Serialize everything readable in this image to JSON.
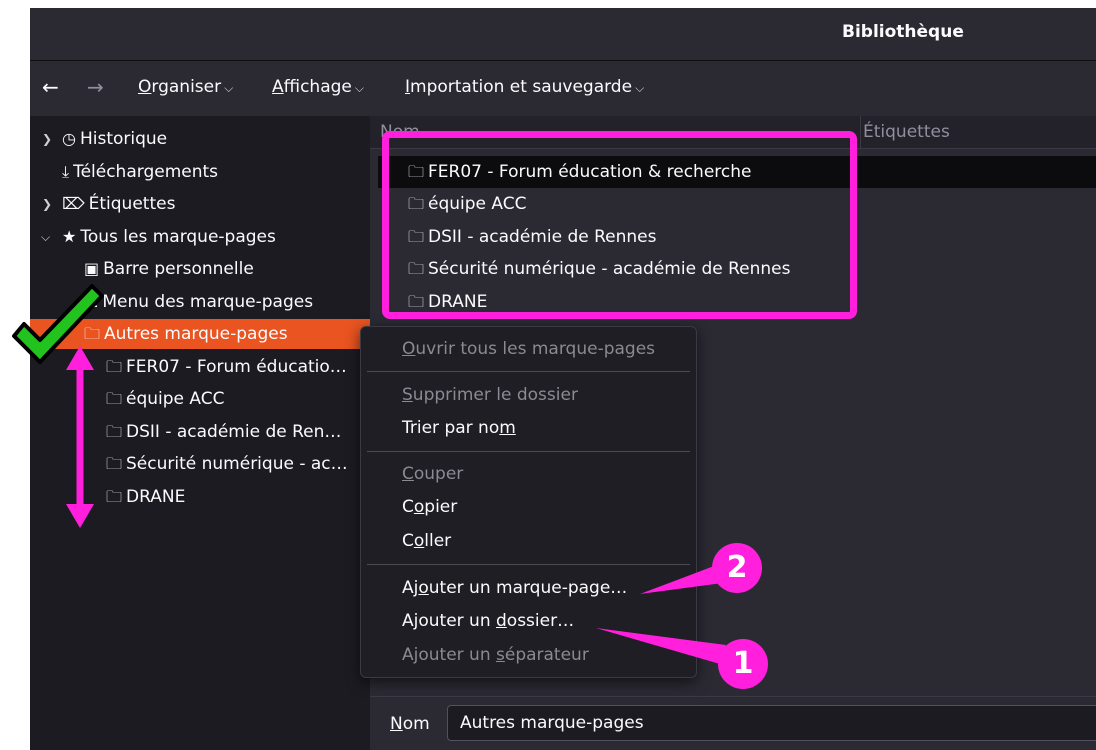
{
  "window": {
    "title": "Bibliothèque"
  },
  "toolbar": {
    "back_icon": "←",
    "forward_icon": "→",
    "organize_prefix": "O",
    "organize_rest": "rganiser",
    "view_prefix": "A",
    "view_rest": "ffichage",
    "import_prefix": "I",
    "import_rest": "mportation et sauvegarde"
  },
  "sidebar": {
    "items": [
      {
        "label": "Historique",
        "icon": "clock-icon"
      },
      {
        "label": "Téléchargements",
        "icon": "download-icon"
      },
      {
        "label": "Étiquettes",
        "icon": "tag-icon"
      },
      {
        "label": "Tous les marque-pages",
        "icon": "star-icon"
      },
      {
        "label": "Barre personnelle",
        "icon": "bookmarks-toolbar-icon"
      },
      {
        "label": "Menu des marque-pages",
        "icon": "bookmarks-menu-icon"
      },
      {
        "label": "Autres marque-pages",
        "icon": "folder-icon"
      },
      {
        "label": "FER07 - Forum éducatio…",
        "icon": "folder-icon"
      },
      {
        "label": "équipe ACC",
        "icon": "folder-icon"
      },
      {
        "label": "DSII - académie de Ren…",
        "icon": "folder-icon"
      },
      {
        "label": "Sécurité numérique - ac…",
        "icon": "folder-icon"
      },
      {
        "label": "DRANE",
        "icon": "folder-icon"
      }
    ]
  },
  "content": {
    "col_name": "Nom",
    "col_tags": "Étiquettes",
    "rows": [
      {
        "label": "FER07 - Forum éducation & recherche"
      },
      {
        "label": "équipe ACC"
      },
      {
        "label": "DSII - académie de Rennes"
      },
      {
        "label": "Sécurité numérique - académie de Rennes"
      },
      {
        "label": "DRANE"
      }
    ]
  },
  "context_menu": {
    "open_all": {
      "pre": "",
      "acc": "O",
      "post": "uvrir tous les marque-pages"
    },
    "delete_folder": {
      "pre": "",
      "acc": "S",
      "post": "upprimer le dossier"
    },
    "sort_by_name": {
      "pre": "Trier par no",
      "acc": "m",
      "post": ""
    },
    "cut": {
      "pre": "",
      "acc": "C",
      "post": "ouper"
    },
    "copy": {
      "pre": "C",
      "acc": "o",
      "post": "pier"
    },
    "paste": {
      "pre": "C",
      "acc": "o",
      "post": "ller"
    },
    "add_bookmark": {
      "pre": "Aj",
      "acc": "o",
      "post": "uter un marque-page…"
    },
    "add_folder": {
      "pre": "Ajouter un ",
      "acc": "d",
      "post": "ossier…"
    },
    "add_separator": {
      "pre": "Ajouter un ",
      "acc": "s",
      "post": "éparateur"
    }
  },
  "bottom": {
    "name_label_acc": "N",
    "name_label_rest": "om",
    "name_value": "Autres marque-pages"
  },
  "annotations": {
    "badge_1": "1",
    "badge_2": "2",
    "highlight_color": "#ff1fdc",
    "check_color": "#22c31e"
  }
}
